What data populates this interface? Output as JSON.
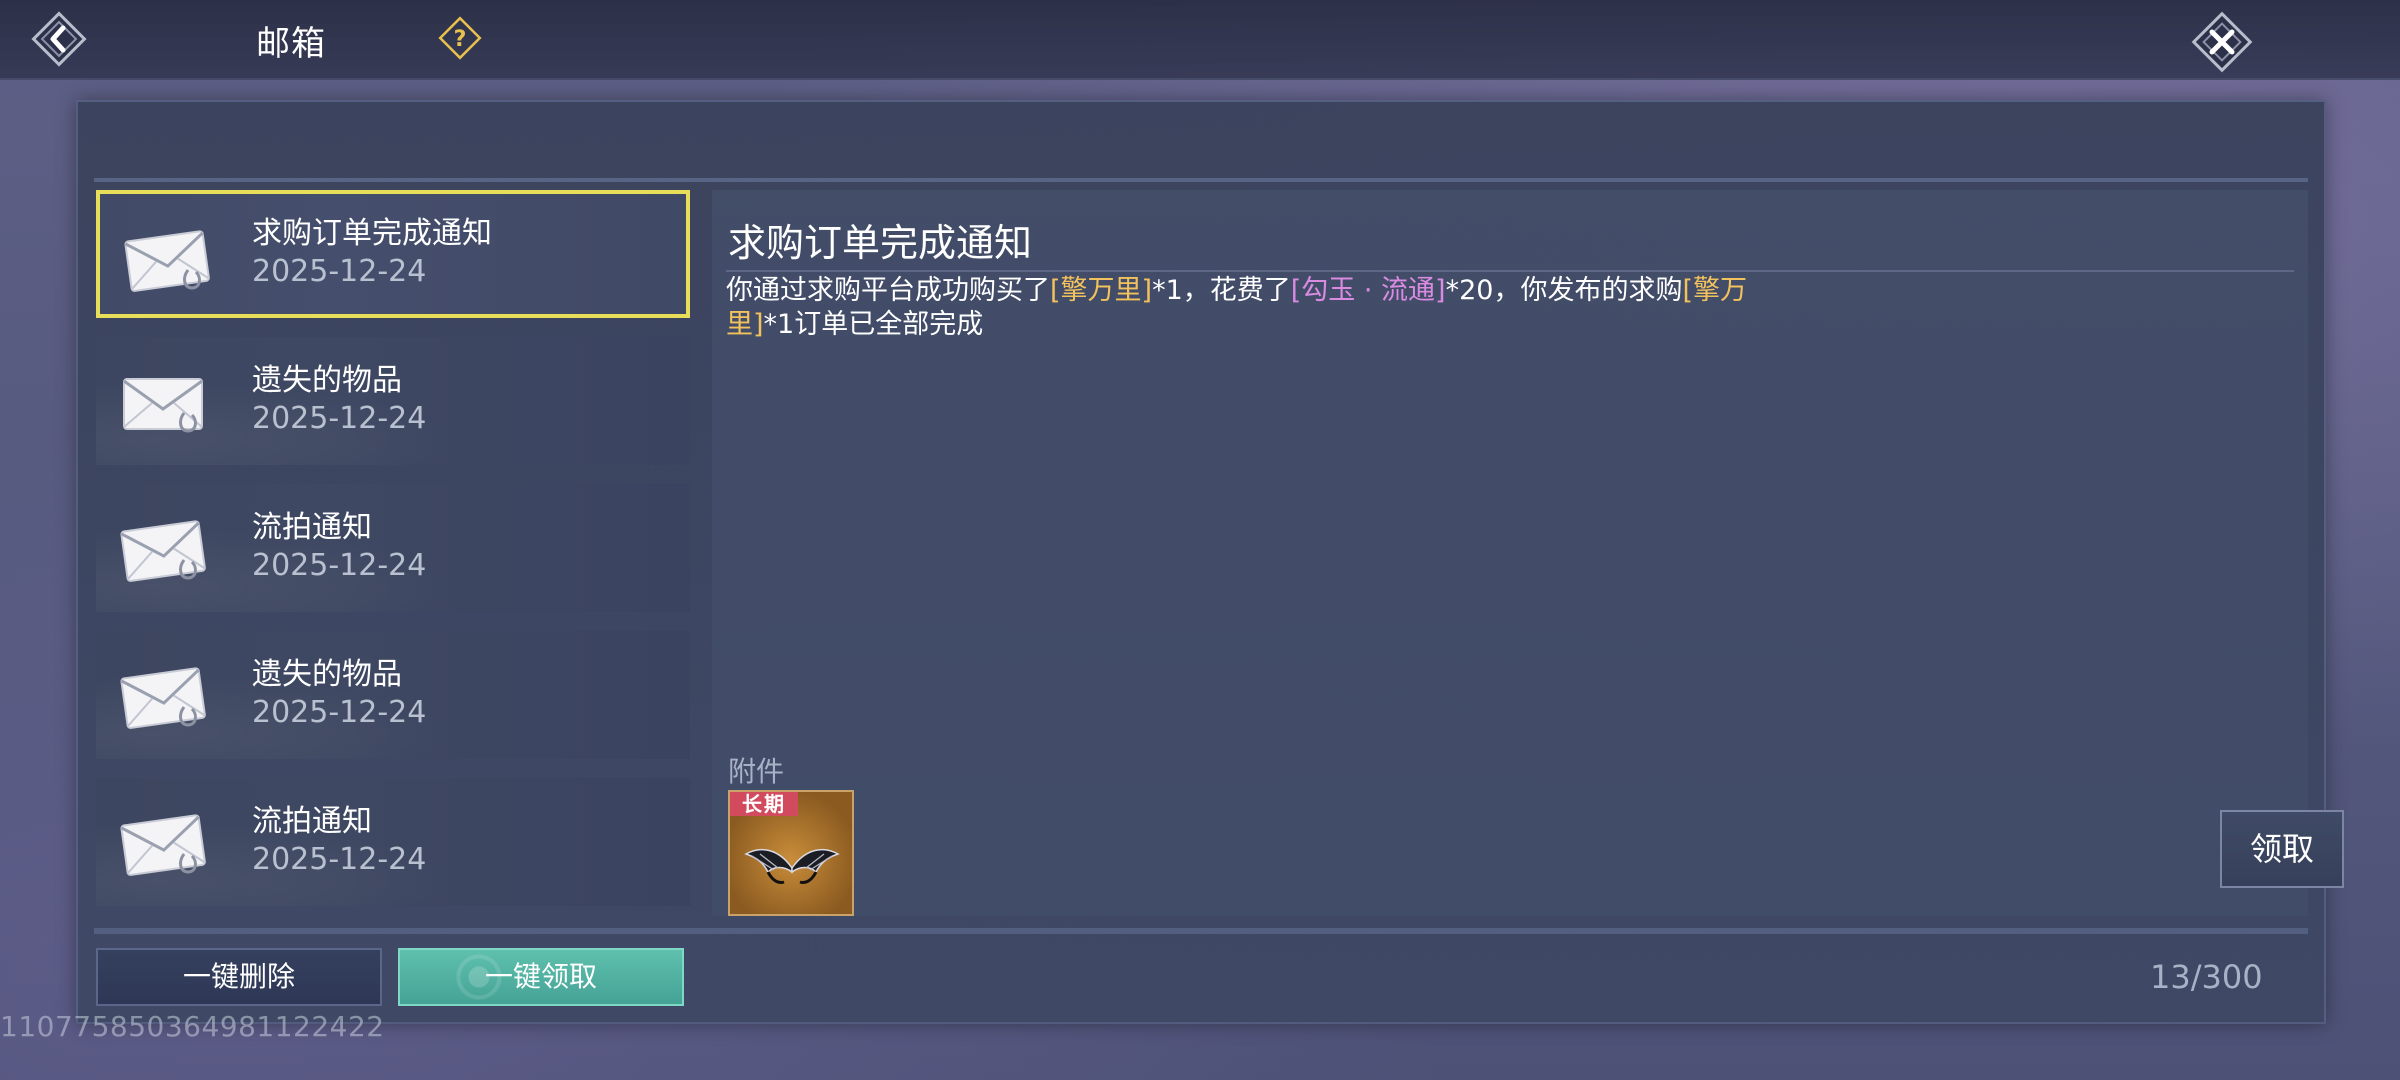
{
  "header": {
    "title": "邮箱"
  },
  "mails": [
    {
      "title": "求购订单完成通知",
      "date": "2025-12-24",
      "selected": true
    },
    {
      "title": "遗失的物品",
      "date": "2025-12-24",
      "selected": false
    },
    {
      "title": "流拍通知",
      "date": "2025-12-24",
      "selected": false
    },
    {
      "title": "遗失的物品",
      "date": "2025-12-24",
      "selected": false
    },
    {
      "title": "流拍通知",
      "date": "2025-12-24",
      "selected": false
    }
  ],
  "detail": {
    "title": "求购订单完成通知",
    "body": {
      "p1": "你通过求购平台成功购买了",
      "item1": "[擎万里]",
      "p2": "*1，花费了",
      "currency": "[勾玉 · 流通]",
      "p3": "*20，你发布的求购",
      "item2": "[擎万里]",
      "p4": "*1订单已全部完成"
    },
    "attachment_label": "附件",
    "attachment_tag": "长期",
    "claim_label": "领取"
  },
  "footer": {
    "delete_all": "一键删除",
    "claim_all": "一键领取",
    "count": "13/300"
  },
  "uid": "110775850364981122422",
  "colors": {
    "selected_border": "#e8de5a",
    "item_highlight": "#f2c25c",
    "currency_highlight": "#d88be0",
    "claim_all_button": "#4fb2a2",
    "tag_red": "#d24a5e"
  },
  "icons": {
    "back": "back-arrow-icon",
    "help": "question-diamond-icon",
    "close": "close-x-icon",
    "mail": "envelope-attachment-icon"
  }
}
